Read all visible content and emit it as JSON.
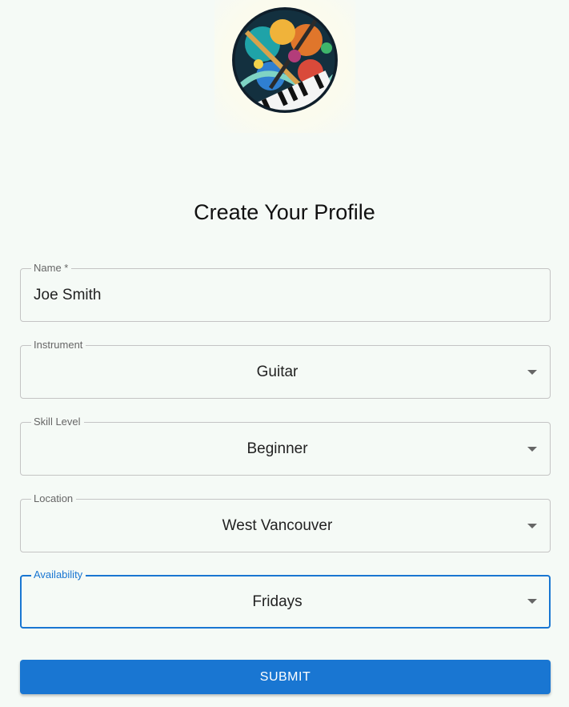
{
  "logo": {
    "icon": "music-instruments-logo"
  },
  "title": "Create Your Profile",
  "form": {
    "name": {
      "label": "Name *",
      "value": "Joe Smith"
    },
    "instrument": {
      "label": "Instrument",
      "value": "Guitar"
    },
    "skill_level": {
      "label": "Skill Level",
      "value": "Beginner"
    },
    "location": {
      "label": "Location",
      "value": "West Vancouver"
    },
    "availability": {
      "label": "Availability",
      "value": "Fridays"
    }
  },
  "submit_label": "SUBMIT",
  "colors": {
    "background": "#f5faf6",
    "accent": "#1976d2",
    "border": "#c4c4c4",
    "label": "#666666"
  }
}
